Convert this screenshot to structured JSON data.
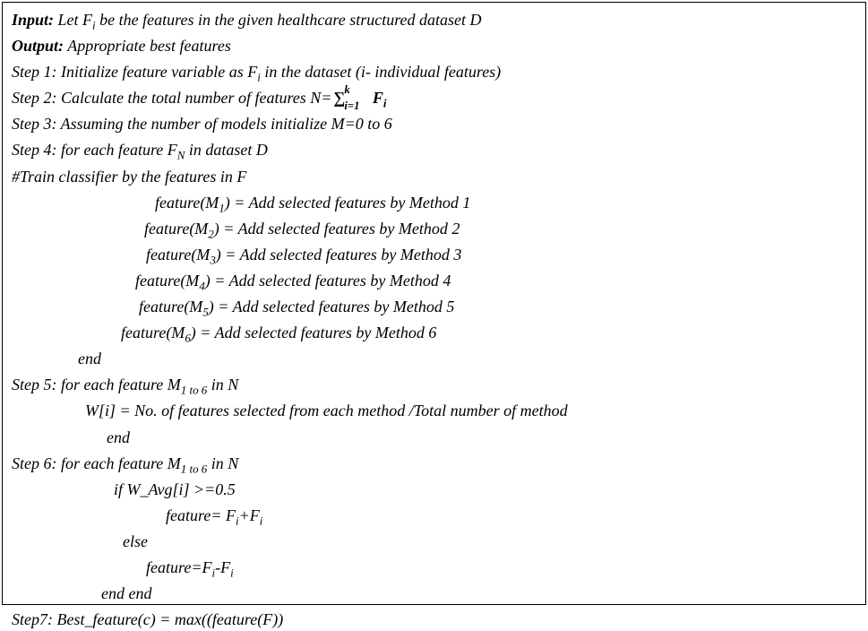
{
  "input_label": "Input:",
  "input_text": " Let F",
  "input_sub": "i",
  "input_text2": " be the features in the given healthcare structured dataset D",
  "output_label": "Output:",
  "output_text": " Appropriate best features",
  "step1_a": "Step 1: Initialize feature variable as F",
  "step1_sub": "i",
  "step1_b": "  in the dataset (i- individual features)",
  "step2_a": "Step 2: Calculate the total number of features N=",
  "sigma_top": "k",
  "sigma_bot": "i=1",
  "sigma_term_a": "F",
  "sigma_term_sub": "i",
  "step3": "Step 3: Assuming the number of models initialize M=0 to 6",
  "step4_a": "Step 4: for each feature F",
  "step4_sub": "N",
  "step4_b": " in dataset D",
  "comment": "#Train classifier by the features in F",
  "m1_a": "feature(M",
  "m1_sub": "1",
  "m1_b": ") =  Add selected features by Method 1",
  "m2_a": "feature(M",
  "m2_sub": "2",
  "m2_b": ") = Add selected features by Method 2",
  "m3_a": "feature(M",
  "m3_sub": "3",
  "m3_b": ") = Add selected features by Method 3",
  "m4_a": "feature(M",
  "m4_sub": "4",
  "m4_b": ") = Add selected features by Method 4",
  "m5_a": "feature(M",
  "m5_sub": "5",
  "m5_b": ") = Add selected features by Method 5",
  "m6_a": "feature(M",
  "m6_sub": "6",
  "m6_b": ") = Add selected features by Method 6",
  "end1": "end",
  "step5_a": "Step 5: for each feature M",
  "step5_sub": "1 to 6",
  "step5_b": " in N",
  "w_line": "W[i] =   No. of features selected from each method /Total number of method",
  "end2": "end",
  "step6_a": "Step 6: for each feature M",
  "step6_sub": "1 to 6",
  "step6_b": " in N",
  "if_line": "if W_Avg[i] >=0.5",
  "feat_add_a": "feature= F",
  "feat_add_sub1": "i",
  "feat_add_b": "+F",
  "feat_add_sub2": "i",
  "else_line": "else",
  "feat_sub_a": "feature=F",
  "feat_sub_sub1": "i",
  "feat_sub_b": "-F",
  "feat_sub_sub2": "i",
  "endend": "end  end",
  "step7": "Step7: Best_feature(c) = max((feature(F))"
}
